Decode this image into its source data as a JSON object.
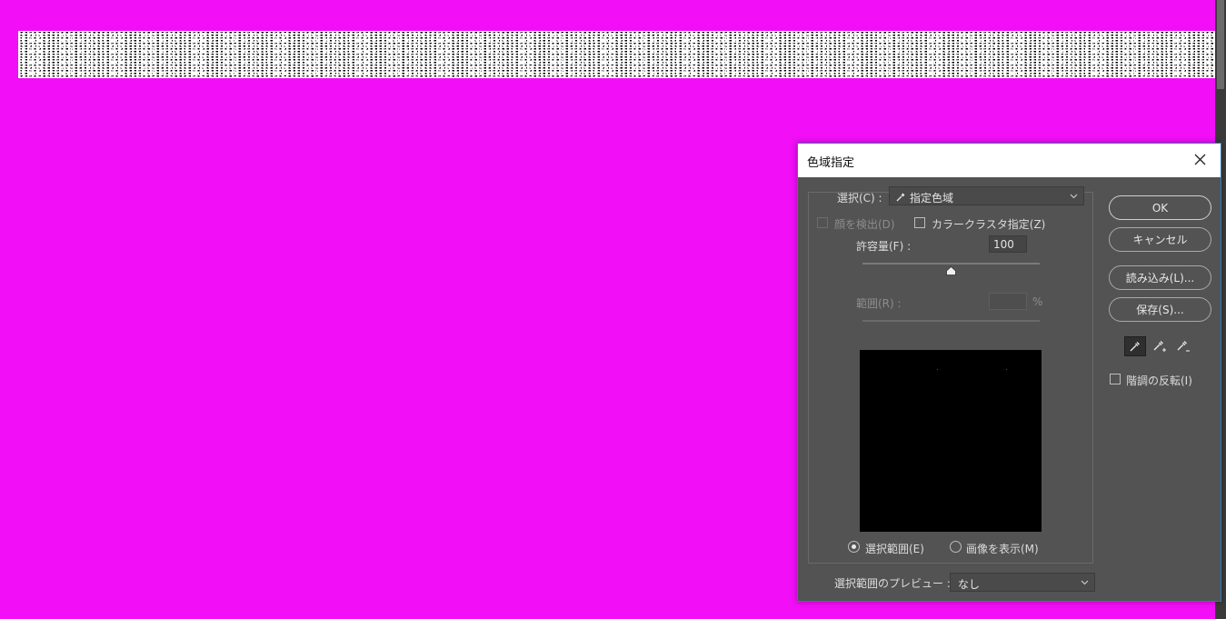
{
  "dialog": {
    "title": "色域指定",
    "select_label": "選択(C) :",
    "select_value": "指定色域",
    "detect_faces_label": "顔を検出(D)",
    "localized_clusters_label": "カラークラスタ指定(Z)",
    "fuzziness_label": "許容量(F) :",
    "fuzziness_value": "100",
    "fuzziness_fraction": 0.5,
    "range_label": "範囲(R) :",
    "range_value": "",
    "range_unit": "%",
    "radio_selection_label": "選択範囲(E)",
    "radio_image_label": "画像を表示(M)",
    "preview_label": "選択範囲のプレビュー :",
    "preview_value": "なし",
    "buttons": {
      "ok": "OK",
      "cancel": "キャンセル",
      "load": "読み込み(L)...",
      "save": "保存(S)..."
    },
    "invert_label": "階調の反転(I)"
  },
  "colors": {
    "canvas_background": "#f20ef7",
    "dialog_background": "#535353",
    "dialog_accent_border": "#2b7bbf"
  },
  "icons": {
    "select_eyedropper": "eyedropper-icon",
    "close": "close-icon",
    "dropdown": "chevron-down-icon",
    "tools": [
      "eyedropper-icon",
      "eyedropper-plus-icon",
      "eyedropper-minus-icon"
    ]
  }
}
